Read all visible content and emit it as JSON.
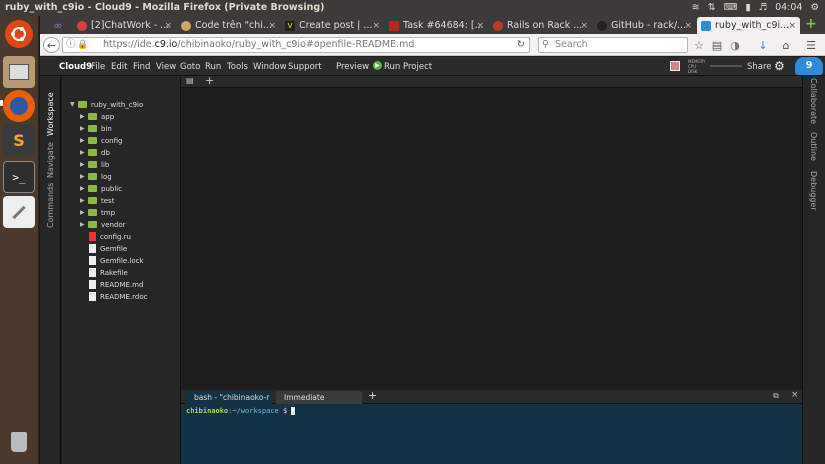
{
  "os": {
    "window_title": "ruby_with_c9io - Cloud9 - Mozilla Firefox (Private Browsing)",
    "clock": "04:04"
  },
  "browser": {
    "tabs": [
      {
        "label": "[2]ChatWork - ...",
        "color": "#d8413e"
      },
      {
        "label": "Code trên \"chi...",
        "color": "#c9a86a"
      },
      {
        "label": "Create post | ...",
        "color": "#222222"
      },
      {
        "label": "Task #64684: [...",
        "color": "#b5291f"
      },
      {
        "label": "Rails on Rack ...",
        "color": "#c0392b"
      },
      {
        "label": "GitHub - rack/...",
        "color": "#222222"
      },
      {
        "label": "ruby_with_c9i...",
        "color": "#2e8bd6"
      }
    ],
    "url_prefix": "https://ide.",
    "url_domain": "c9.io",
    "url_path": "/chibinaoko/ruby_with_c9io#openfile-README.md",
    "search_placeholder": "Search"
  },
  "c9": {
    "menu": [
      "Cloud9",
      "File",
      "Edit",
      "Find",
      "View",
      "Goto",
      "Run",
      "Tools",
      "Window",
      "Support"
    ],
    "preview": "Preview",
    "run_project": "Run Project",
    "share": "Share",
    "left_labels": [
      "Workspace",
      "Navigate",
      "Commands"
    ],
    "right_labels": [
      "Collaborate",
      "Outline",
      "Debugger"
    ],
    "stats": [
      "MEMORY",
      "CPU",
      "DISK"
    ],
    "tree": {
      "root": "ruby_with_c9io",
      "folders": [
        "app",
        "bin",
        "config",
        "db",
        "lib",
        "log",
        "public",
        "test",
        "tmp",
        "vendor"
      ],
      "files": [
        "config.ru",
        "Gemfile",
        "Gemfile.lock",
        "Rakefile",
        "README.md",
        "README.rdoc"
      ]
    },
    "terminal": {
      "tab1": "bash - \"chibinaoko-r",
      "tab2": "Immediate",
      "user": "chibinaoko",
      "path": ":~/workspace",
      "prompt_symbol": "$"
    }
  }
}
